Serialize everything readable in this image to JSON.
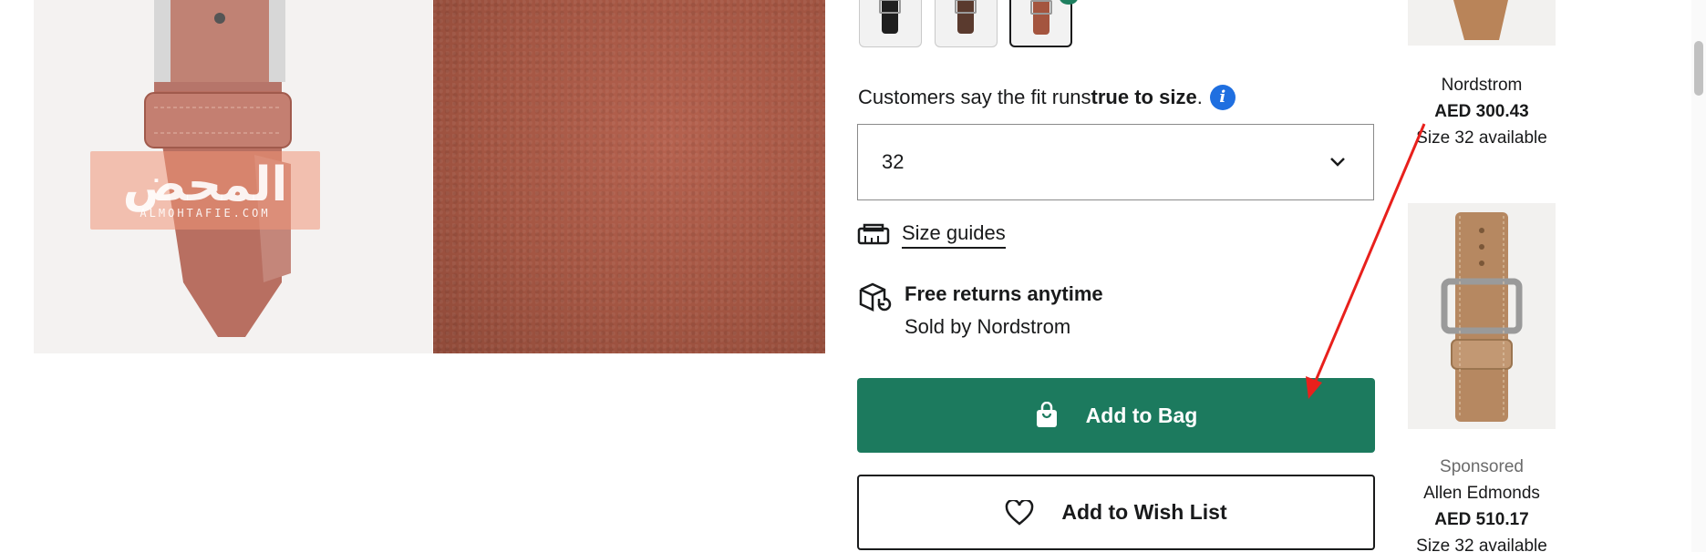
{
  "product": {
    "fit_prefix": "Customers say the fit runs ",
    "fit_bold": "true to size",
    "fit_suffix": ".",
    "size_selected": "32",
    "size_guides_label": "Size guides",
    "returns_title": "Free returns anytime",
    "sold_by": "Sold by Nordstrom",
    "add_to_bag_label": "Add to Bag",
    "add_to_wish_label": "Add to Wish List"
  },
  "swatches": [
    {
      "name": "black",
      "color": "#1f1f1f"
    },
    {
      "name": "dark-brown",
      "color": "#5a3a2e"
    },
    {
      "name": "cognac",
      "color": "#a4553f",
      "selected": true
    }
  ],
  "watermark": {
    "main": "المحض",
    "sub": "ALMOHTAFIE.COM"
  },
  "recommendations": [
    {
      "brand": "Nordstrom",
      "price": "AED 300.43",
      "availability": "Size 32 available"
    },
    {
      "sponsored": "Sponsored",
      "brand": "Allen Edmonds",
      "price": "AED 510.17",
      "availability": "Size 32 available"
    }
  ],
  "colors": {
    "primary_green": "#1c7a5e",
    "info_blue": "#1f6fe0",
    "annotation_red": "#e8201c"
  }
}
